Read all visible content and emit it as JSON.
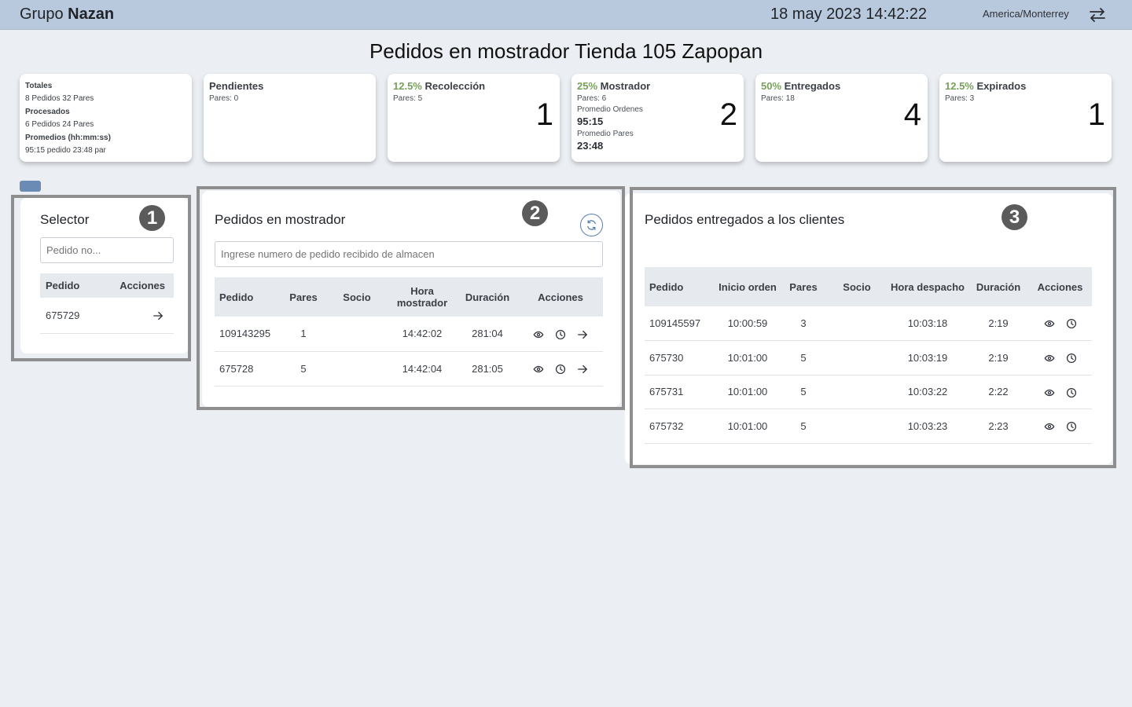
{
  "header": {
    "brand_prefix": "Grupo",
    "brand_name": "Nazan",
    "datetime": "18 may 2023 14:42:22",
    "timezone": "America/Monterrey",
    "swap_icon": "swap-arrows-icon"
  },
  "page_title": "Pedidos en mostrador Tienda 105 Zapopan",
  "stats": {
    "totals": {
      "totales_label": "Totales",
      "totales_value": "8 Pedidos 32 Pares",
      "procesados_label": "Procesados",
      "procesados_value": "6 Pedidos 24 Pares",
      "promedios_label": "Promedios (hh:mm:ss)",
      "promedios_value": "95:15 pedido 23:48 par"
    },
    "pendientes": {
      "title": "Pendientes",
      "pares": "Pares: 0"
    },
    "recoleccion": {
      "pct": "12.5%",
      "title": "Recolección",
      "pares": "Pares: 5",
      "count": "1"
    },
    "mostrador": {
      "pct": "25%",
      "title": "Mostrador",
      "pares": "Pares: 6",
      "count": "2",
      "prom_ordenes_label": "Promedio Ordenes",
      "prom_ordenes": "95:15",
      "prom_pares_label": "Promedio Pares",
      "prom_pares": "23:48"
    },
    "entregados": {
      "pct": "50%",
      "title": "Entregados",
      "pares": "Pares: 18",
      "count": "4"
    },
    "expirados": {
      "pct": "12.5%",
      "title": "Expirados",
      "pares": "Pares: 3",
      "count": "1"
    }
  },
  "selector": {
    "title": "Selector",
    "badge": "1",
    "placeholder": "Pedido no...",
    "columns": [
      "Pedido",
      "Acciones"
    ],
    "rows": [
      {
        "pedido": "675729"
      }
    ]
  },
  "mostrador_panel": {
    "title": "Pedidos en mostrador",
    "badge": "2",
    "placeholder": "Ingrese numero de pedido recibido de almacen",
    "columns": [
      "Pedido",
      "Pares",
      "Socio",
      "Hora mostrador",
      "Duración",
      "Acciones"
    ],
    "rows": [
      {
        "pedido": "109143295",
        "pares": "1",
        "socio": "",
        "hora": "14:42:02",
        "duracion": "281:04"
      },
      {
        "pedido": "675728",
        "pares": "5",
        "socio": "",
        "hora": "14:42:04",
        "duracion": "281:05"
      }
    ]
  },
  "entregados_panel": {
    "title": "Pedidos entregados a los clientes",
    "badge": "3",
    "columns": [
      "Pedido",
      "Inicio orden",
      "Pares",
      "Socio",
      "Hora despacho",
      "Duración",
      "Acciones"
    ],
    "rows": [
      {
        "pedido": "109145597",
        "inicio": "10:00:59",
        "pares": "3",
        "socio": "",
        "hora": "10:03:18",
        "duracion": "2:19"
      },
      {
        "pedido": "675730",
        "inicio": "10:01:00",
        "pares": "5",
        "socio": "",
        "hora": "10:03:19",
        "duracion": "2:19"
      },
      {
        "pedido": "675731",
        "inicio": "10:01:00",
        "pares": "5",
        "socio": "",
        "hora": "10:03:22",
        "duracion": "2:22"
      },
      {
        "pedido": "675732",
        "inicio": "10:01:00",
        "pares": "5",
        "socio": "",
        "hora": "10:03:23",
        "duracion": "2:23"
      }
    ]
  },
  "colors": {
    "topbar": "#b9c9dd",
    "accent_pct": "#77a05a",
    "badge": "#5b5b5b",
    "button": "#6b8bb5"
  }
}
